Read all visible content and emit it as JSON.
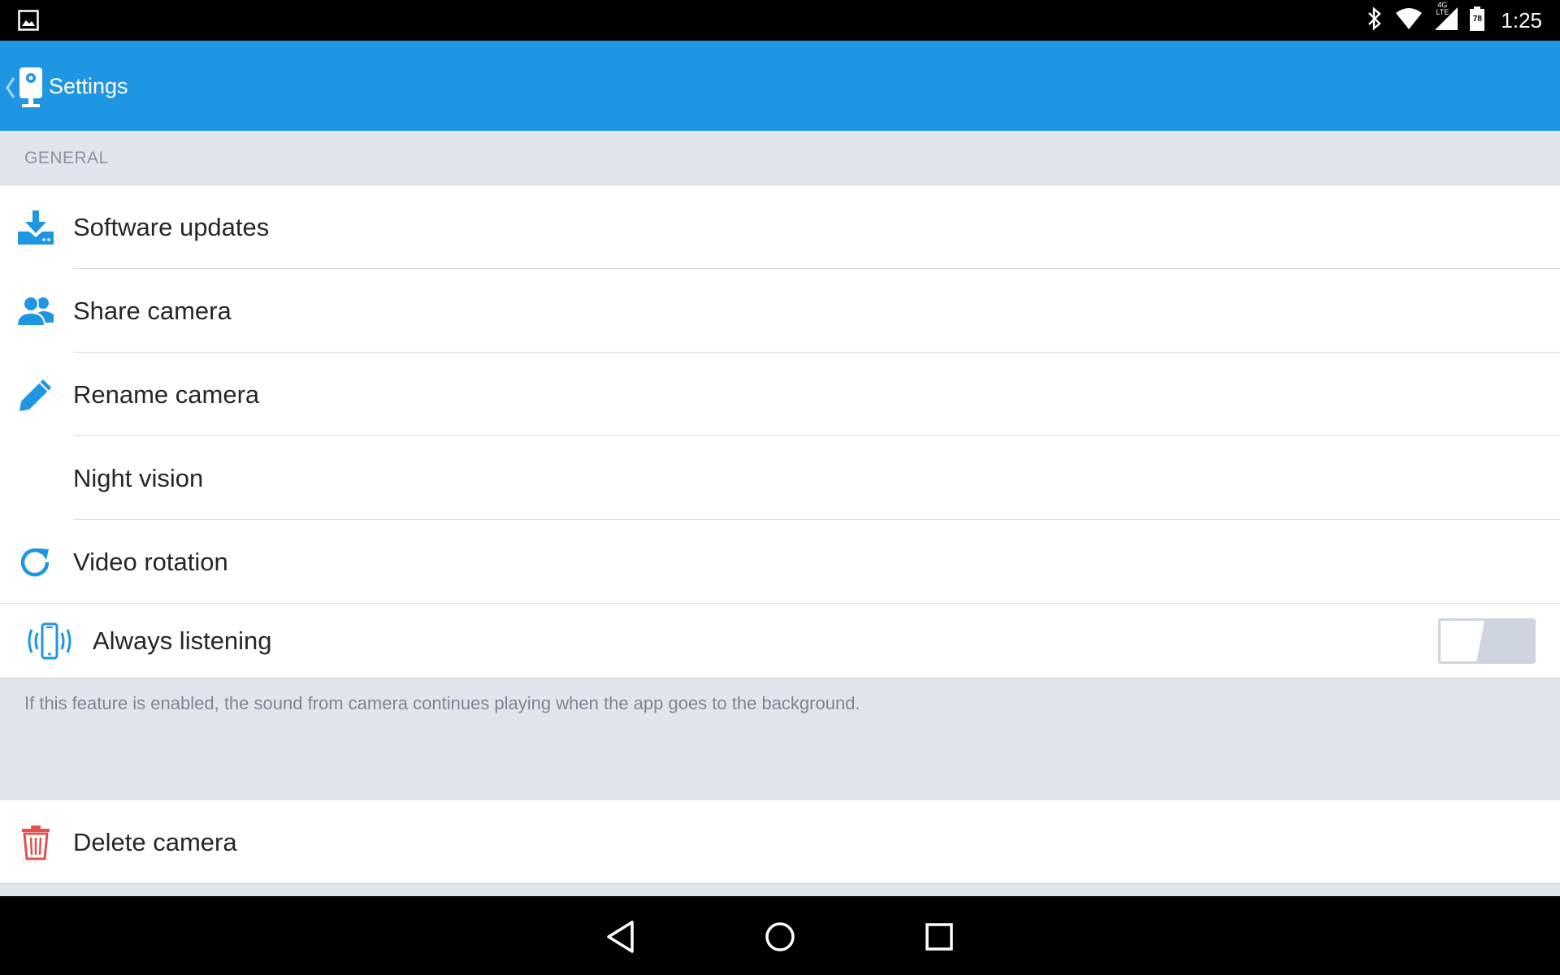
{
  "status_bar": {
    "time": "1:25",
    "battery_level": "78",
    "network": "4G LTE",
    "icons": [
      "image-notification-icon",
      "bluetooth-icon",
      "wifi-icon",
      "cell-signal-icon",
      "battery-icon"
    ]
  },
  "app_bar": {
    "title": "Settings",
    "icons": [
      "back-chevron-icon",
      "camera-app-icon"
    ]
  },
  "general": {
    "header": "GENERAL",
    "items": [
      {
        "label": "Software updates",
        "icon": "download-icon"
      },
      {
        "label": "Share camera",
        "icon": "users-icon"
      },
      {
        "label": "Rename camera",
        "icon": "pencil-icon"
      },
      {
        "label": "Night vision",
        "icon": "moon-icon"
      },
      {
        "label": "Video rotation",
        "icon": "rotate-icon"
      }
    ],
    "always_listening": {
      "label": "Always listening",
      "icon": "phone-vibrate-icon",
      "enabled": false
    },
    "note": "If this feature is enabled, the sound from camera continues playing when the app goes to the background."
  },
  "danger": {
    "delete_label": "Delete camera",
    "icon": "trash-icon"
  },
  "nav_bar": {
    "icons": [
      "nav-back-icon",
      "nav-home-icon",
      "nav-recents-icon"
    ]
  },
  "colors": {
    "accent": "#1e96e2",
    "danger": "#e2504e",
    "section_background": "#e1e5ec",
    "text_primary": "#262626",
    "text_secondary": "#8a94a2"
  }
}
